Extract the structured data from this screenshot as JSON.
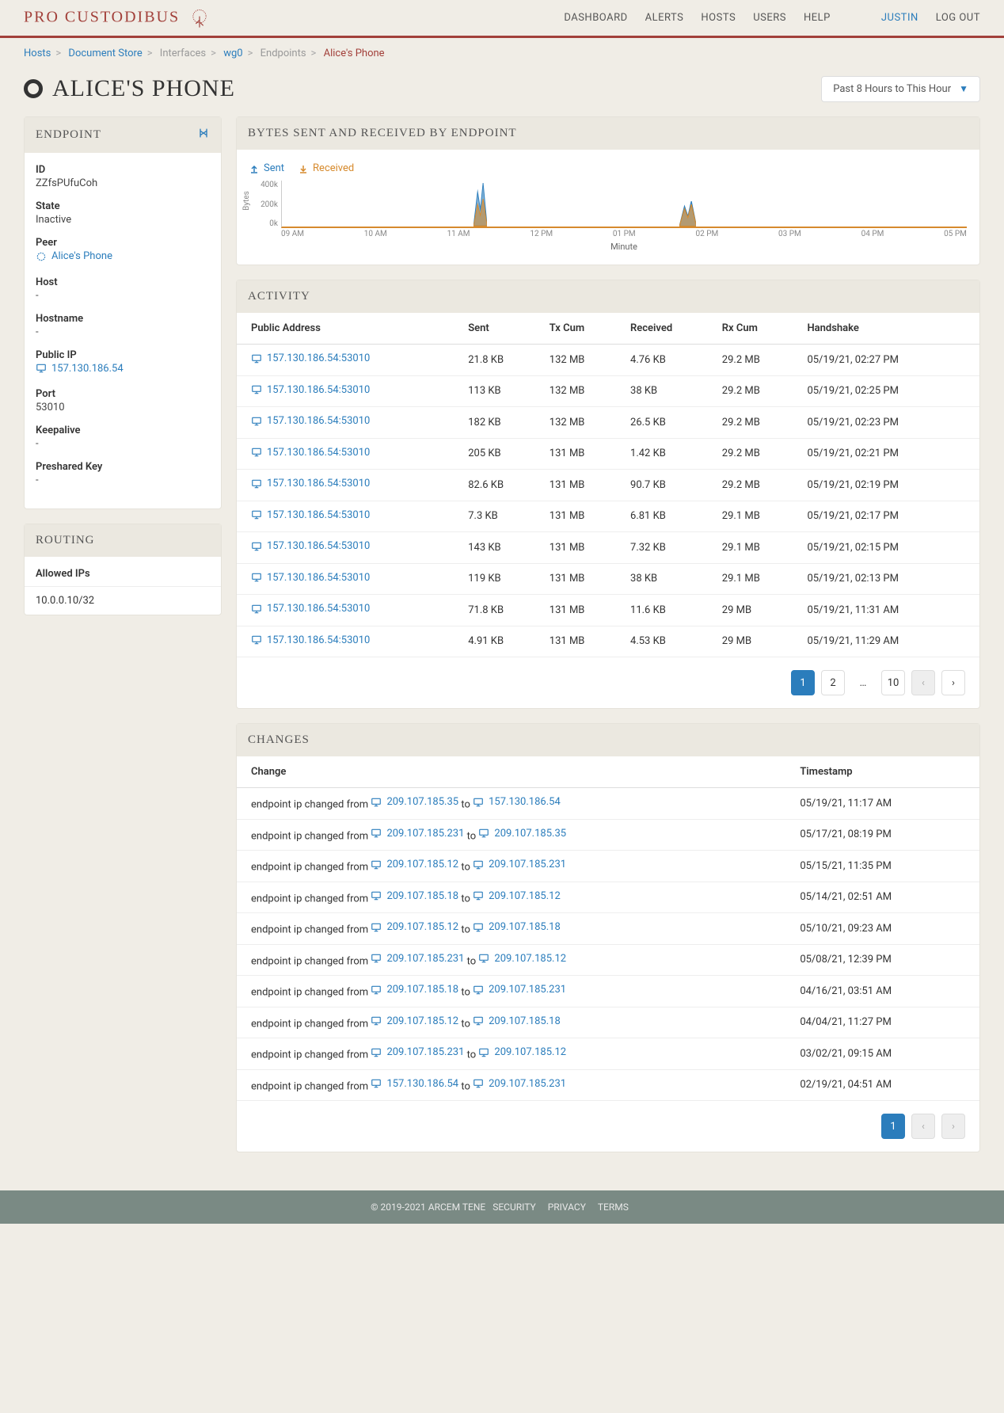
{
  "brand": "PRO CUSTODIBUS",
  "nav": {
    "dashboard": "DASHBOARD",
    "alerts": "ALERTS",
    "hosts": "HOSTS",
    "users": "USERS",
    "help": "HELP",
    "user": "JUSTIN",
    "logout": "LOG OUT"
  },
  "breadcrumb": {
    "hosts": "Hosts",
    "doc": "Document Store",
    "interfaces": "Interfaces",
    "wg0": "wg0",
    "endpoints": "Endpoints",
    "current": "Alice's Phone"
  },
  "page_title": "ALICE'S PHONE",
  "time_range": "Past 8 Hours to This Hour",
  "endpoint": {
    "title": "ENDPOINT",
    "fields": {
      "id": {
        "label": "ID",
        "value": "ZZfsPUfuCoh"
      },
      "state": {
        "label": "State",
        "value": "Inactive"
      },
      "peer": {
        "label": "Peer",
        "value": "Alice's Phone"
      },
      "host": {
        "label": "Host",
        "value": "-"
      },
      "hostname": {
        "label": "Hostname",
        "value": "-"
      },
      "public_ip": {
        "label": "Public IP",
        "value": "157.130.186.54"
      },
      "port": {
        "label": "Port",
        "value": "53010"
      },
      "keepalive": {
        "label": "Keepalive",
        "value": "-"
      },
      "psk": {
        "label": "Preshared Key",
        "value": "-"
      }
    }
  },
  "routing": {
    "title": "ROUTING",
    "allowed_label": "Allowed IPs",
    "allowed_value": "10.0.0.10/32"
  },
  "chart_panel": {
    "title": "BYTES SENT AND RECEIVED BY ENDPOINT",
    "legend": {
      "sent": "Sent",
      "received": "Received"
    }
  },
  "chart_data": {
    "type": "area",
    "xlabel": "Minute",
    "ylabel": "Bytes",
    "y_ticks": [
      "400k",
      "200k",
      "0k"
    ],
    "x_ticks": [
      "09 AM",
      "10 AM",
      "11 AM",
      "12 PM",
      "01 PM",
      "02 PM",
      "03 PM",
      "04 PM",
      "05 PM"
    ],
    "series": [
      {
        "name": "Sent",
        "color": "#2b7dbc",
        "spikes": [
          {
            "x_pct": 28,
            "height_pct": 95,
            "width_pct": 2
          },
          {
            "x_pct": 58,
            "height_pct": 55,
            "width_pct": 2.5
          }
        ]
      },
      {
        "name": "Received",
        "color": "#d68a2d",
        "spikes": [
          {
            "x_pct": 28,
            "height_pct": 60,
            "width_pct": 2
          },
          {
            "x_pct": 58,
            "height_pct": 48,
            "width_pct": 2.5
          }
        ]
      }
    ]
  },
  "activity": {
    "title": "ACTIVITY",
    "columns": [
      "Public Address",
      "Sent",
      "Tx Cum",
      "Received",
      "Rx Cum",
      "Handshake"
    ],
    "rows": [
      {
        "addr": "157.130.186.54:53010",
        "sent": "21.8 KB",
        "tx": "132 MB",
        "recv": "4.76 KB",
        "rx": "29.2 MB",
        "hs": "05/19/21, 02:27 PM"
      },
      {
        "addr": "157.130.186.54:53010",
        "sent": "113 KB",
        "tx": "132 MB",
        "recv": "38 KB",
        "rx": "29.2 MB",
        "hs": "05/19/21, 02:25 PM"
      },
      {
        "addr": "157.130.186.54:53010",
        "sent": "182 KB",
        "tx": "132 MB",
        "recv": "26.5 KB",
        "rx": "29.2 MB",
        "hs": "05/19/21, 02:23 PM"
      },
      {
        "addr": "157.130.186.54:53010",
        "sent": "205 KB",
        "tx": "131 MB",
        "recv": "1.42 KB",
        "rx": "29.2 MB",
        "hs": "05/19/21, 02:21 PM"
      },
      {
        "addr": "157.130.186.54:53010",
        "sent": "82.6 KB",
        "tx": "131 MB",
        "recv": "90.7 KB",
        "rx": "29.2 MB",
        "hs": "05/19/21, 02:19 PM"
      },
      {
        "addr": "157.130.186.54:53010",
        "sent": "7.3 KB",
        "tx": "131 MB",
        "recv": "6.81 KB",
        "rx": "29.1 MB",
        "hs": "05/19/21, 02:17 PM"
      },
      {
        "addr": "157.130.186.54:53010",
        "sent": "143 KB",
        "tx": "131 MB",
        "recv": "7.32 KB",
        "rx": "29.1 MB",
        "hs": "05/19/21, 02:15 PM"
      },
      {
        "addr": "157.130.186.54:53010",
        "sent": "119 KB",
        "tx": "131 MB",
        "recv": "38 KB",
        "rx": "29.1 MB",
        "hs": "05/19/21, 02:13 PM"
      },
      {
        "addr": "157.130.186.54:53010",
        "sent": "71.8 KB",
        "tx": "131 MB",
        "recv": "11.6 KB",
        "rx": "29 MB",
        "hs": "05/19/21, 11:31 AM"
      },
      {
        "addr": "157.130.186.54:53010",
        "sent": "4.91 KB",
        "tx": "131 MB",
        "recv": "4.53 KB",
        "rx": "29 MB",
        "hs": "05/19/21, 11:29 AM"
      }
    ],
    "pager": {
      "pages": [
        "1",
        "2",
        "…",
        "10"
      ],
      "active": "1"
    }
  },
  "changes": {
    "title": "CHANGES",
    "columns": [
      "Change",
      "Timestamp"
    ],
    "prefix": "endpoint ip changed from",
    "to": "to",
    "rows": [
      {
        "from": "209.107.185.35",
        "to": "157.130.186.54",
        "ts": "05/19/21, 11:17 AM"
      },
      {
        "from": "209.107.185.231",
        "to": "209.107.185.35",
        "ts": "05/17/21, 08:19 PM"
      },
      {
        "from": "209.107.185.12",
        "to": "209.107.185.231",
        "ts": "05/15/21, 11:35 PM"
      },
      {
        "from": "209.107.185.18",
        "to": "209.107.185.12",
        "ts": "05/14/21, 02:51 AM"
      },
      {
        "from": "209.107.185.12",
        "to": "209.107.185.18",
        "ts": "05/10/21, 09:23 AM"
      },
      {
        "from": "209.107.185.231",
        "to": "209.107.185.12",
        "ts": "05/08/21, 12:39 PM"
      },
      {
        "from": "209.107.185.18",
        "to": "209.107.185.231",
        "ts": "04/16/21, 03:51 AM"
      },
      {
        "from": "209.107.185.12",
        "to": "209.107.185.18",
        "ts": "04/04/21, 11:27 PM"
      },
      {
        "from": "209.107.185.231",
        "to": "209.107.185.12",
        "ts": "03/02/21, 09:15 AM"
      },
      {
        "from": "157.130.186.54",
        "to": "209.107.185.231",
        "ts": "02/19/21, 04:51 AM"
      }
    ],
    "pager": {
      "pages": [
        "1"
      ],
      "active": "1"
    }
  },
  "footer": {
    "copyright": "© 2019-2021 ARCEM TENE",
    "security": "SECURITY",
    "privacy": "PRIVACY",
    "terms": "TERMS"
  }
}
